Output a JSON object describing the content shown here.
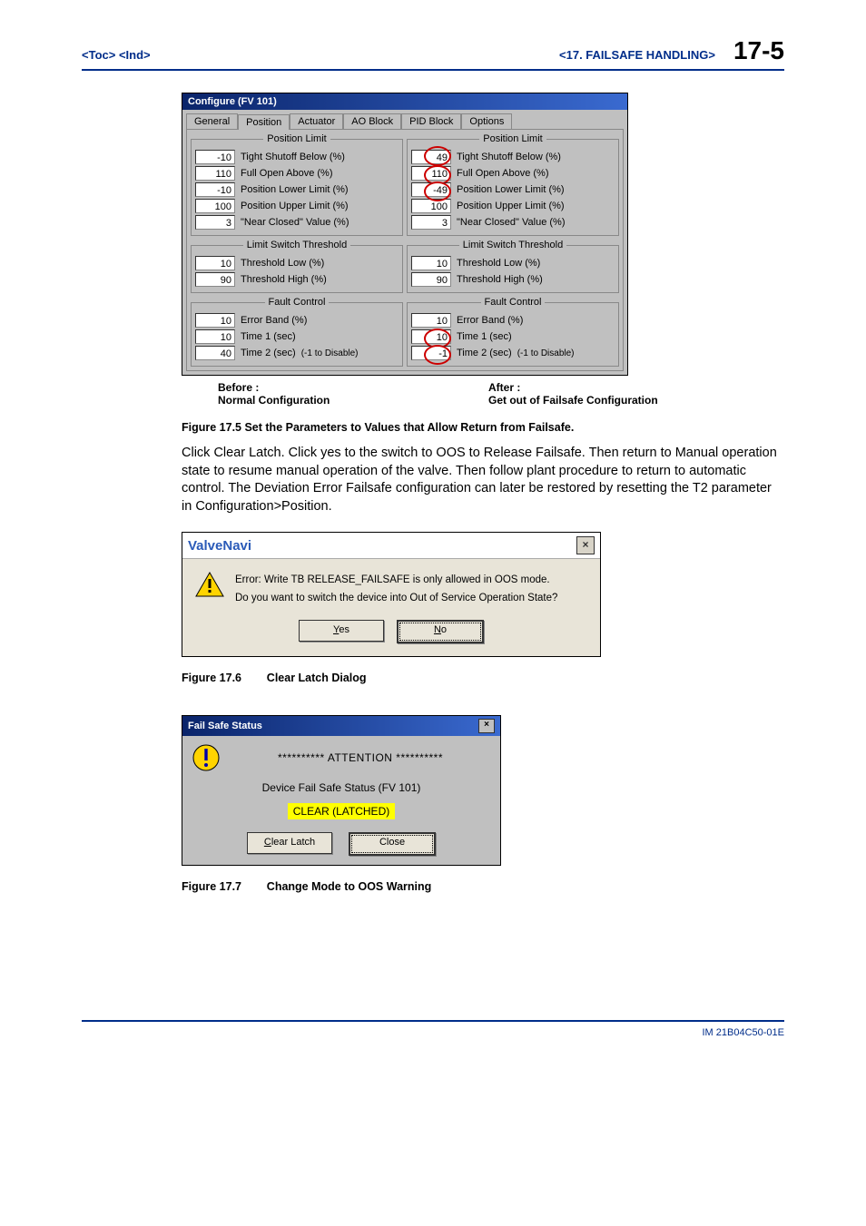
{
  "header": {
    "toc": "<Toc> <Ind>",
    "chapter": "<17.  FAILSAFE HANDLING>",
    "page": "17-5"
  },
  "configure_window": {
    "title": "Configure (FV 101)",
    "tabs": [
      "General",
      "Position",
      "Actuator",
      "AO Block",
      "PID Block",
      "Options"
    ],
    "active_tab_index": 1,
    "group_labels": {
      "position_limit": "Position Limit",
      "limit_switch_threshold": "Limit Switch Threshold",
      "fault_control": "Fault Control"
    },
    "field_labels": {
      "tight_shutoff": "Tight Shutoff Below (%)",
      "full_open": "Full Open Above (%)",
      "lower_limit": "Position Lower Limit (%)",
      "upper_limit": "Position Upper Limit (%)",
      "near_closed": "\"Near Closed\" Value (%)",
      "thresh_low": "Threshold Low (%)",
      "thresh_high": "Threshold High (%)",
      "error_band": "Error Band (%)",
      "time1": "Time 1 (sec)",
      "time2": "Time 2 (sec)",
      "disable_note": "(-1 to Disable)"
    },
    "before": {
      "tight_shutoff": "-10",
      "full_open": "110",
      "lower_limit": "-10",
      "upper_limit": "100",
      "near_closed": "3",
      "thresh_low": "10",
      "thresh_high": "90",
      "error_band": "10",
      "time1": "10",
      "time2": "40"
    },
    "after": {
      "tight_shutoff": "49",
      "full_open": "110",
      "lower_limit": "-49",
      "upper_limit": "100",
      "near_closed": "3",
      "thresh_low": "10",
      "thresh_high": "90",
      "error_band": "10",
      "time1": "10",
      "time2": "-1"
    },
    "under": {
      "before_title": "Before :",
      "before_sub": "Normal Configuration",
      "after_title": "After :",
      "after_sub": "Get out of Failsafe Configuration"
    }
  },
  "figure17_5": "Figure 17.5  Set the Parameters to Values that Allow Return from Failsafe.",
  "body_paragraph": "Click Clear Latch.  Click yes to the switch to OOS to Release Failsafe.  Then return to Manual operation state to resume manual operation of the valve.  Then follow plant procedure to return to automatic control.  The Deviation Error Failsafe configuration can later be restored by resetting the T2 parameter in Configuration>Position.",
  "dialog1": {
    "title": "ValveNavi",
    "line1": "Error: Write TB RELEASE_FAILSAFE is only allowed in OOS mode.",
    "line2": "Do you want to switch the device into Out of Service Operation State?",
    "yes": "Yes",
    "no": "No"
  },
  "figure17_6": {
    "num": "Figure 17.6",
    "title": "Clear Latch Dialog"
  },
  "dialog2": {
    "title": "Fail Safe Status",
    "attention": "********** ATTENTION **********",
    "device_line": "Device Fail Safe Status (FV 101)",
    "status": "CLEAR (LATCHED)",
    "clear": "Clear Latch",
    "close": "Close"
  },
  "figure17_7": {
    "num": "Figure 17.7",
    "title": "Change Mode to OOS Warning"
  },
  "footer": "IM 21B04C50-01E"
}
